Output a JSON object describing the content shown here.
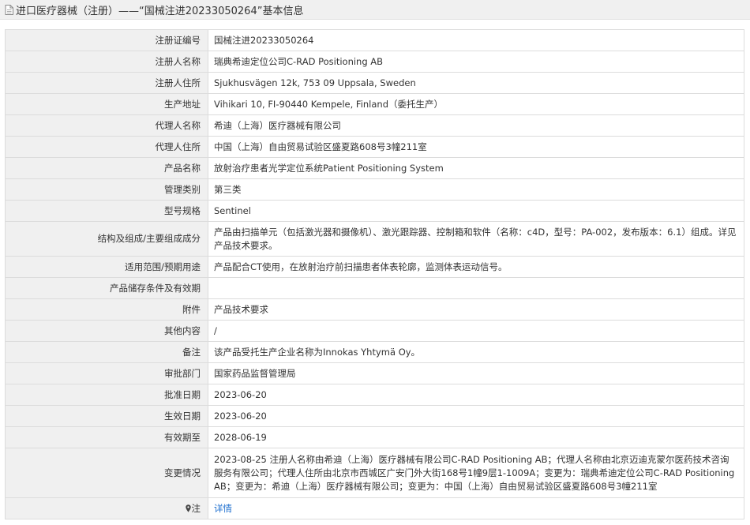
{
  "header": {
    "title": "进口医疗器械（注册）——“国械注进20233050264”基本信息"
  },
  "rows": [
    {
      "label": "注册证编号",
      "value": "国械注进20233050264"
    },
    {
      "label": "注册人名称",
      "value": "瑞典希迪定位公司C-RAD Positioning AB"
    },
    {
      "label": "注册人住所",
      "value": "Sjukhusvägen 12k, 753 09 Uppsala, Sweden"
    },
    {
      "label": "生产地址",
      "value": "Vihikari 10, FI-90440 Kempele, Finland（委托生产）"
    },
    {
      "label": "代理人名称",
      "value": "希迪（上海）医疗器械有限公司"
    },
    {
      "label": "代理人住所",
      "value": "中国（上海）自由贸易试验区盛夏路608号3幢211室"
    },
    {
      "label": "产品名称",
      "value": "放射治疗患者光学定位系统Patient Positioning System"
    },
    {
      "label": "管理类别",
      "value": "第三类"
    },
    {
      "label": "型号规格",
      "value": "Sentinel"
    },
    {
      "label": "结构及组成/主要组成成分",
      "value": "产品由扫描单元（包括激光器和摄像机）、激光跟踪器、控制箱和软件（名称：c4D，型号：PA-002，发布版本：6.1）组成。详见产品技术要求。"
    },
    {
      "label": "适用范围/预期用途",
      "value": "产品配合CT使用，在放射治疗前扫描患者体表轮廓，监测体表运动信号。"
    },
    {
      "label": "产品储存条件及有效期",
      "value": ""
    },
    {
      "label": "附件",
      "value": "产品技术要求"
    },
    {
      "label": "其他内容",
      "value": "/"
    },
    {
      "label": "备注",
      "value": "该产品受托生产企业名称为Innokas Yhtymä Oy。"
    },
    {
      "label": "审批部门",
      "value": "国家药品监督管理局"
    },
    {
      "label": "批准日期",
      "value": "2023-06-20"
    },
    {
      "label": "生效日期",
      "value": "2023-06-20"
    },
    {
      "label": "有效期至",
      "value": "2028-06-19"
    },
    {
      "label": "变更情况",
      "value": "2023-08-25 注册人名称由希迪（上海）医疗器械有限公司C-RAD Positioning AB；代理人名称由北京迈迪克蒙尔医药技术咨询服务有限公司；代理人住所由北京市西城区广安门外大街168号1幢9层1-1009A；变更为：瑞典希迪定位公司C-RAD Positioning AB；变更为：希迪（上海）医疗器械有限公司；变更为：中国（上海）自由贸易试验区盛夏路608号3幢211室"
    }
  ],
  "note": {
    "label": "注",
    "link_text": "详情",
    "icon": "map-pin-icon"
  },
  "colors": {
    "label_bg": "#f0f0f0",
    "border": "#dcdcdc",
    "link": "#1e6fcf"
  }
}
